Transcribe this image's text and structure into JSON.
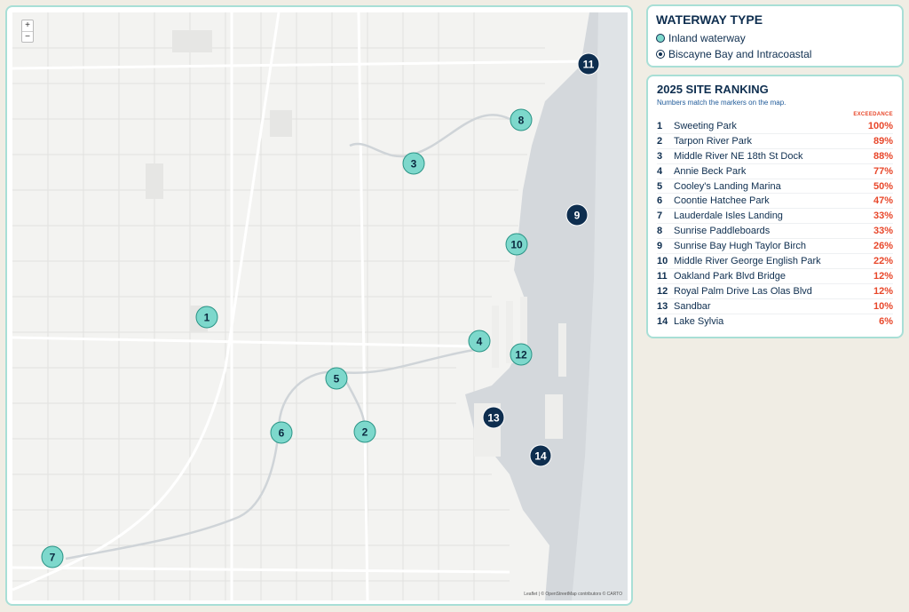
{
  "map": {
    "zoom_in": "+",
    "zoom_out": "−",
    "attribution": "Leaflet | © OpenStreetMap contributors © CARTO",
    "markers": [
      {
        "id": "1",
        "type": "inland"
      },
      {
        "id": "2",
        "type": "inland"
      },
      {
        "id": "3",
        "type": "inland"
      },
      {
        "id": "4",
        "type": "inland"
      },
      {
        "id": "5",
        "type": "inland"
      },
      {
        "id": "6",
        "type": "inland"
      },
      {
        "id": "7",
        "type": "inland"
      },
      {
        "id": "8",
        "type": "inland"
      },
      {
        "id": "9",
        "type": "bay"
      },
      {
        "id": "10",
        "type": "inland"
      },
      {
        "id": "11",
        "type": "bay"
      },
      {
        "id": "12",
        "type": "inland"
      },
      {
        "id": "13",
        "type": "bay"
      },
      {
        "id": "14",
        "type": "bay"
      }
    ],
    "colors": {
      "inland": "#7dd8cc",
      "bay": "#0e2e4f",
      "water": "#d4d8dc",
      "land": "#f3f3f1"
    }
  },
  "legend": {
    "title": "WATERWAY TYPE",
    "items": [
      {
        "label": "Inland waterway",
        "type": "inland"
      },
      {
        "label": "Biscayne Bay and Intracoastal",
        "type": "bay"
      }
    ]
  },
  "ranking": {
    "title": "2025 SITE RANKING",
    "subtitle": "Numbers match the markers on the map.",
    "column_header": "EXCEEDANCE",
    "rows": [
      {
        "rank": "1",
        "name": "Sweeting Park",
        "value": "100%"
      },
      {
        "rank": "2",
        "name": "Tarpon River Park",
        "value": "89%"
      },
      {
        "rank": "3",
        "name": "Middle River NE 18th St Dock",
        "value": "88%"
      },
      {
        "rank": "4",
        "name": "Annie Beck Park",
        "value": "77%"
      },
      {
        "rank": "5",
        "name": "Cooley's Landing Marina",
        "value": "50%"
      },
      {
        "rank": "6",
        "name": "Coontie Hatchee Park",
        "value": "47%"
      },
      {
        "rank": "7",
        "name": "Lauderdale Isles Landing",
        "value": "33%"
      },
      {
        "rank": "8",
        "name": "Sunrise Paddleboards",
        "value": "33%"
      },
      {
        "rank": "9",
        "name": "Sunrise Bay Hugh Taylor Birch",
        "value": "26%"
      },
      {
        "rank": "10",
        "name": "Middle River George English Park",
        "value": "22%"
      },
      {
        "rank": "11",
        "name": "Oakland Park Blvd Bridge",
        "value": "12%"
      },
      {
        "rank": "12",
        "name": "Royal Palm Drive Las Olas Blvd",
        "value": "12%"
      },
      {
        "rank": "13",
        "name": "Sandbar",
        "value": "10%"
      },
      {
        "rank": "14",
        "name": "Lake Sylvia",
        "value": "6%"
      }
    ]
  }
}
